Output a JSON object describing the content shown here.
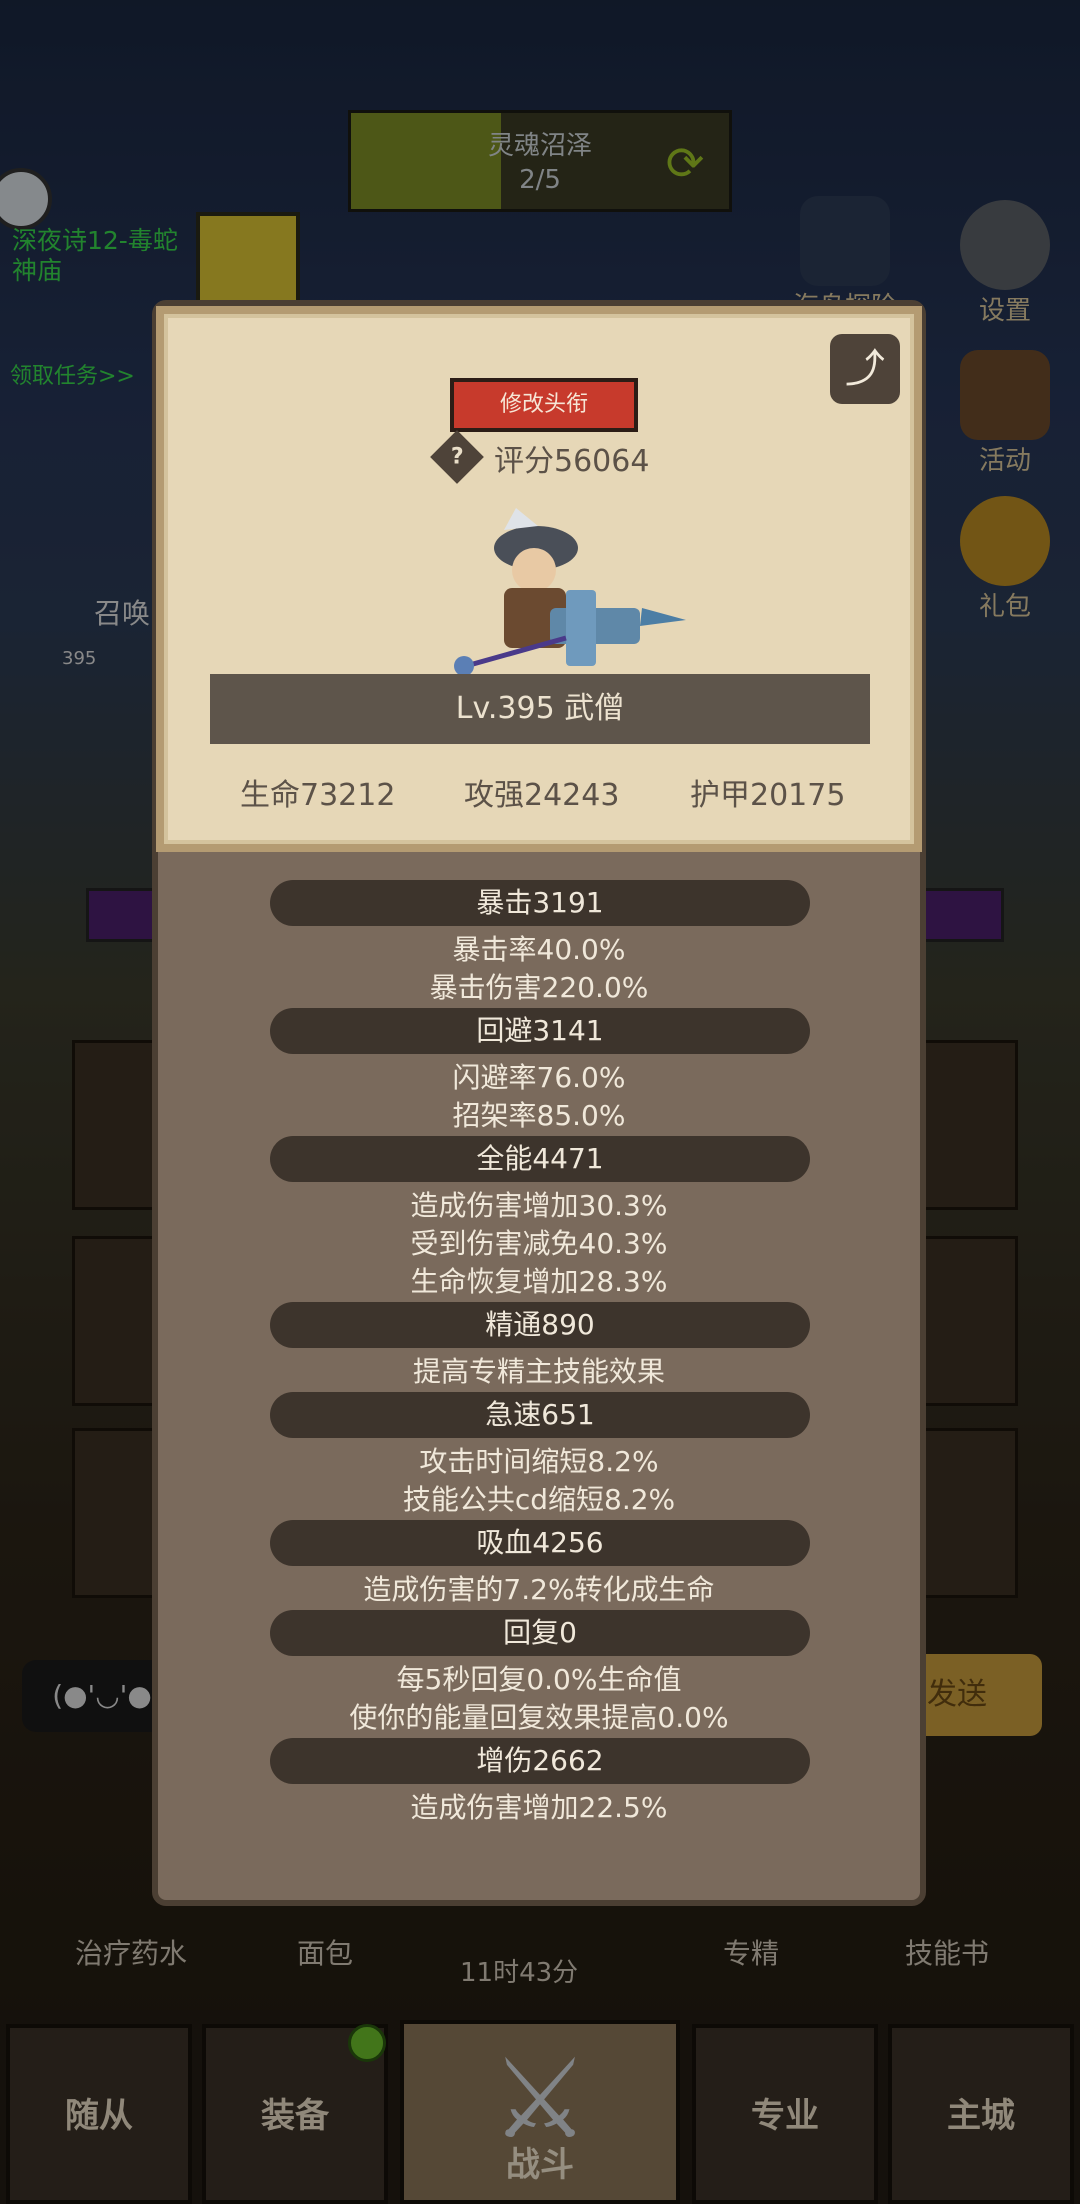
{
  "background": {
    "zone_progress": {
      "name": "灵魂沼泽",
      "count": "2/5"
    },
    "quest": {
      "text": "深夜诗12-毒蛇神庙",
      "claim": "领取任务>>"
    },
    "right_menu": [
      {
        "label": "海岛探险II"
      },
      {
        "label": "设置"
      },
      {
        "label": "活动"
      },
      {
        "label": "礼包"
      }
    ],
    "summon_label": "召唤",
    "summon_level": "395",
    "chat_placeholder": "(●'◡'●",
    "send_label": "发送",
    "skills": [
      {
        "label": "治疗药水"
      },
      {
        "label": "面包"
      },
      {
        "label": "专精"
      },
      {
        "label": "技能书"
      }
    ],
    "timer": "11时43分",
    "nav": [
      {
        "label": "随从"
      },
      {
        "label": "装备"
      },
      {
        "label": "战斗"
      },
      {
        "label": "专业"
      },
      {
        "label": "主城"
      }
    ]
  },
  "modal": {
    "edit_title_label": "修改头衔",
    "help_symbol": "?",
    "score": "评分56064",
    "level_class": "Lv.395 武僧",
    "hp": "生命73212",
    "attack": "攻强24243",
    "armor": "护甲20175",
    "stat_groups": [
      {
        "header": "暴击3191",
        "lines": [
          "暴击率40.0%",
          "暴击伤害220.0%"
        ]
      },
      {
        "header": "回避3141",
        "lines": [
          "闪避率76.0%",
          "招架率85.0%"
        ]
      },
      {
        "header": "全能4471",
        "lines": [
          "造成伤害增加30.3%",
          "受到伤害减免40.3%",
          "生命恢复增加28.3%"
        ]
      },
      {
        "header": "精通890",
        "lines": [
          "提高专精主技能效果"
        ]
      },
      {
        "header": "急速651",
        "lines": [
          "攻击时间缩短8.2%",
          "技能公共cd缩短8.2%"
        ]
      },
      {
        "header": "吸血4256",
        "lines": [
          "造成伤害的7.2%转化成生命"
        ]
      },
      {
        "header": "回复0",
        "lines": [
          "每5秒回复0.0%生命值",
          "使你的能量回复效果提高0.0%"
        ]
      },
      {
        "header": "增伤2662",
        "lines": [
          "造成伤害增加22.5%"
        ]
      }
    ]
  }
}
